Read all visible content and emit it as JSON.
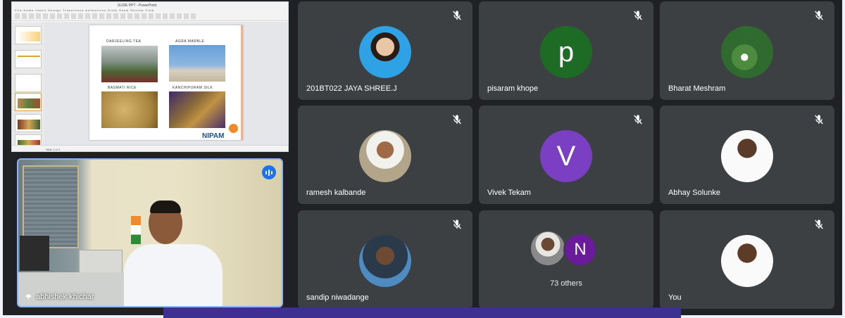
{
  "shared_screen": {
    "window_title": "SLIDE PPT - PowerPoint",
    "ribbon_tabs": "File Home Insert Design Transitions Animations Slide Show Review View",
    "status_text": "Slide 1 of 4",
    "slide": {
      "captions": [
        "Darjeeling Tea",
        "Agra Marble",
        "Basmati Rice",
        "Kanchipuram Silk"
      ],
      "logo_text": "NIPAM"
    }
  },
  "presenter": {
    "name": "abhishek khichar"
  },
  "tiles": [
    {
      "name": "201BT022 JAYA SHREE.J",
      "type": "photo",
      "muted": true
    },
    {
      "name": "pisaram khope",
      "type": "letter",
      "letter": "p",
      "color": "#1e6b26",
      "muted": true
    },
    {
      "name": "Bharat Meshram",
      "type": "photo",
      "muted": true
    },
    {
      "name": "ramesh kalbande",
      "type": "photo",
      "muted": true
    },
    {
      "name": "Vivek Tekam",
      "type": "letter",
      "letter": "V",
      "color": "#7b3fc4",
      "muted": true
    },
    {
      "name": "Abhay Solunke",
      "type": "photo",
      "muted": true
    },
    {
      "name": "sandip niwadange",
      "type": "photo",
      "muted": true
    },
    {
      "name": "73 others",
      "type": "group",
      "letter": "N",
      "muted": false
    },
    {
      "name": "You",
      "type": "photo",
      "muted": true
    }
  ],
  "icons": {
    "mute": "mic-off-icon",
    "speaking": "audio-level-icon",
    "pin": "pin-icon"
  },
  "colors": {
    "background": "#202124",
    "tile": "#3c4043",
    "speaking_accent": "#1a73e8",
    "bottom_bar": "#3e2f92"
  }
}
